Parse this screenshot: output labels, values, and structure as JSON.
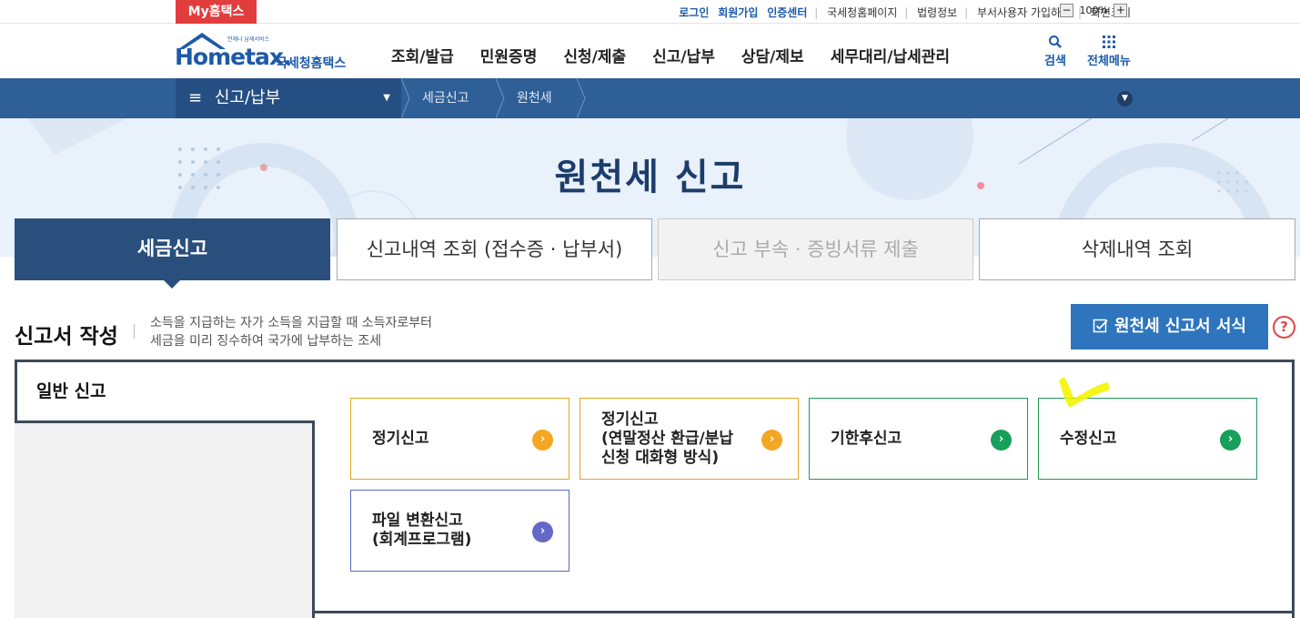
{
  "utility_bar": {
    "my_tab": "My홈택스",
    "login": "로그인",
    "signup": "회원가입",
    "cert_center": "인증센터",
    "nts_home": "국세청홈페이지",
    "law_info": "법령정보",
    "dept_user": "부서사용자 가입하기",
    "screen_size_label": "화면크기",
    "zoom_level": "100%",
    "zoom_out": "−",
    "zoom_in": "+"
  },
  "header": {
    "logo_brand": "Hometax.",
    "logo_sub": "국세청홈택스",
    "logo_tiny": "언제나 납세서비스",
    "menu": [
      "조회/발급",
      "민원증명",
      "신청/제출",
      "신고/납부",
      "상담/제보",
      "세무대리/납세관리"
    ],
    "search_label": "검색",
    "all_menu_label": "전체메뉴"
  },
  "nav": {
    "section": "신고/납부",
    "breadcrumb": [
      "세금신고",
      "원천세"
    ]
  },
  "hero": {
    "title": "원천세 신고"
  },
  "tabs": [
    {
      "label": "세금신고",
      "state": "active"
    },
    {
      "label": "신고내역 조회 (접수증 · 납부서)",
      "state": "normal"
    },
    {
      "label": "신고 부속 · 증빙서류 제출",
      "state": "disabled"
    },
    {
      "label": "삭제내역 조회",
      "state": "normal"
    }
  ],
  "section": {
    "title": "신고서 작성",
    "desc_line1": "소득을 지급하는 자가 소득을 지급할 때 소득자로부터",
    "desc_line2": "세금을 미리 징수하여 국가에 납부하는 조세",
    "form_button": "원천세 신고서 서식",
    "help": "?"
  },
  "panel": {
    "label": "일반 신고",
    "cards": [
      {
        "line1": "정기신고",
        "line2": "",
        "line3": "",
        "color": "orange"
      },
      {
        "line1": "정기신고",
        "line2": "(연말정산 환급/분납",
        "line3": "신청 대화형 방식)",
        "color": "orange"
      },
      {
        "line1": "기한후신고",
        "line2": "",
        "line3": "",
        "color": "green"
      },
      {
        "line1": "수정신고",
        "line2": "",
        "line3": "",
        "color": "green"
      },
      {
        "line1": "파일 변환신고",
        "line2": "(회계프로그램)",
        "line3": "",
        "color": "purple"
      }
    ]
  },
  "colors": {
    "primary_blue": "#2f5f97",
    "active_tab": "#2a4f7c",
    "accent_red": "#e23d3d",
    "orange": "#f5a623",
    "green": "#17a05a",
    "purple": "#6468c8",
    "highlight_yellow": "#f7f700"
  }
}
